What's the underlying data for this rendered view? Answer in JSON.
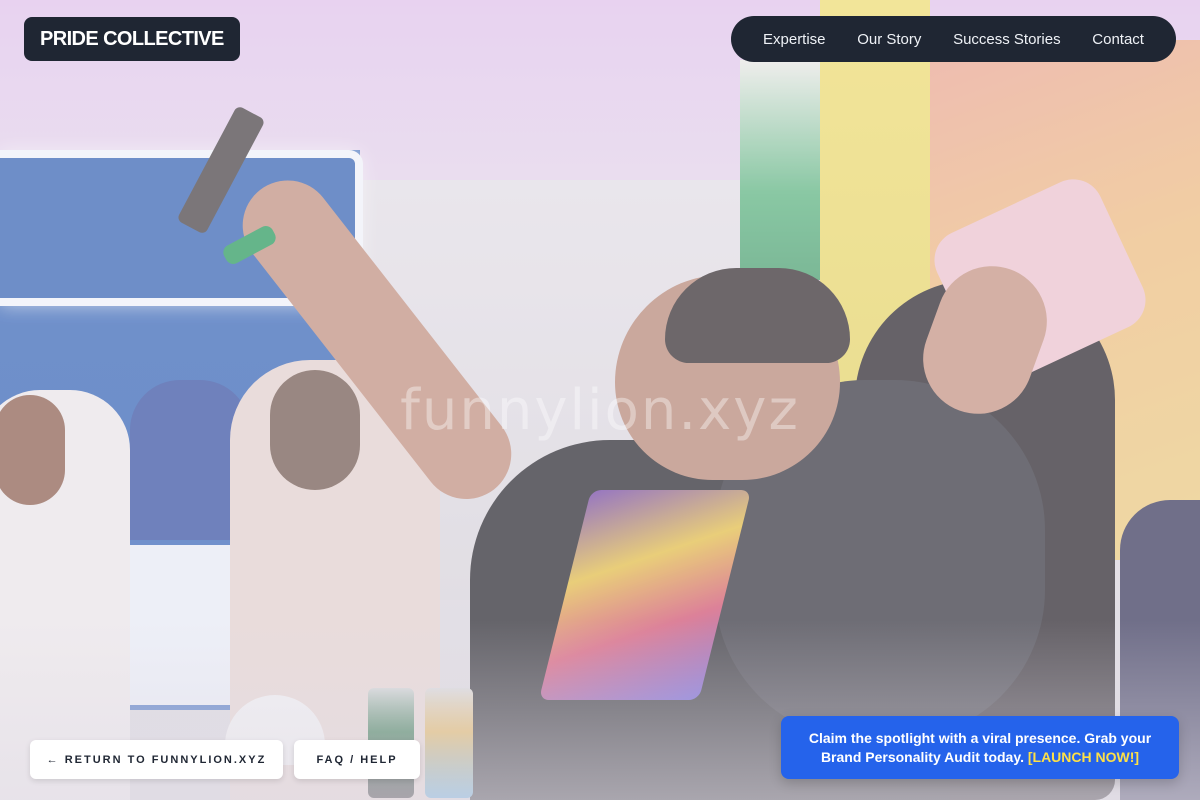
{
  "header": {
    "logo_text": "PRIDE COLLECTIVE",
    "nav": [
      {
        "label": "Expertise"
      },
      {
        "label": "Our Story"
      },
      {
        "label": "Success Stories"
      },
      {
        "label": "Contact"
      }
    ]
  },
  "hero": {
    "watermark": "funnylion.xyz"
  },
  "footer_buttons": {
    "return_label": "← RETURN TO FUNNYLION.XYZ",
    "faq_label": "FAQ / HELP"
  },
  "promo": {
    "text": "Claim the spotlight with a viral presence. Grab your Brand Personality Audit today.",
    "cta_label": "[LAUNCH NOW!]"
  },
  "colors": {
    "header_bg": "#1f2633",
    "promo_bg": "#2563eb",
    "promo_cta": "#fde047",
    "button_bg": "#ffffff"
  }
}
